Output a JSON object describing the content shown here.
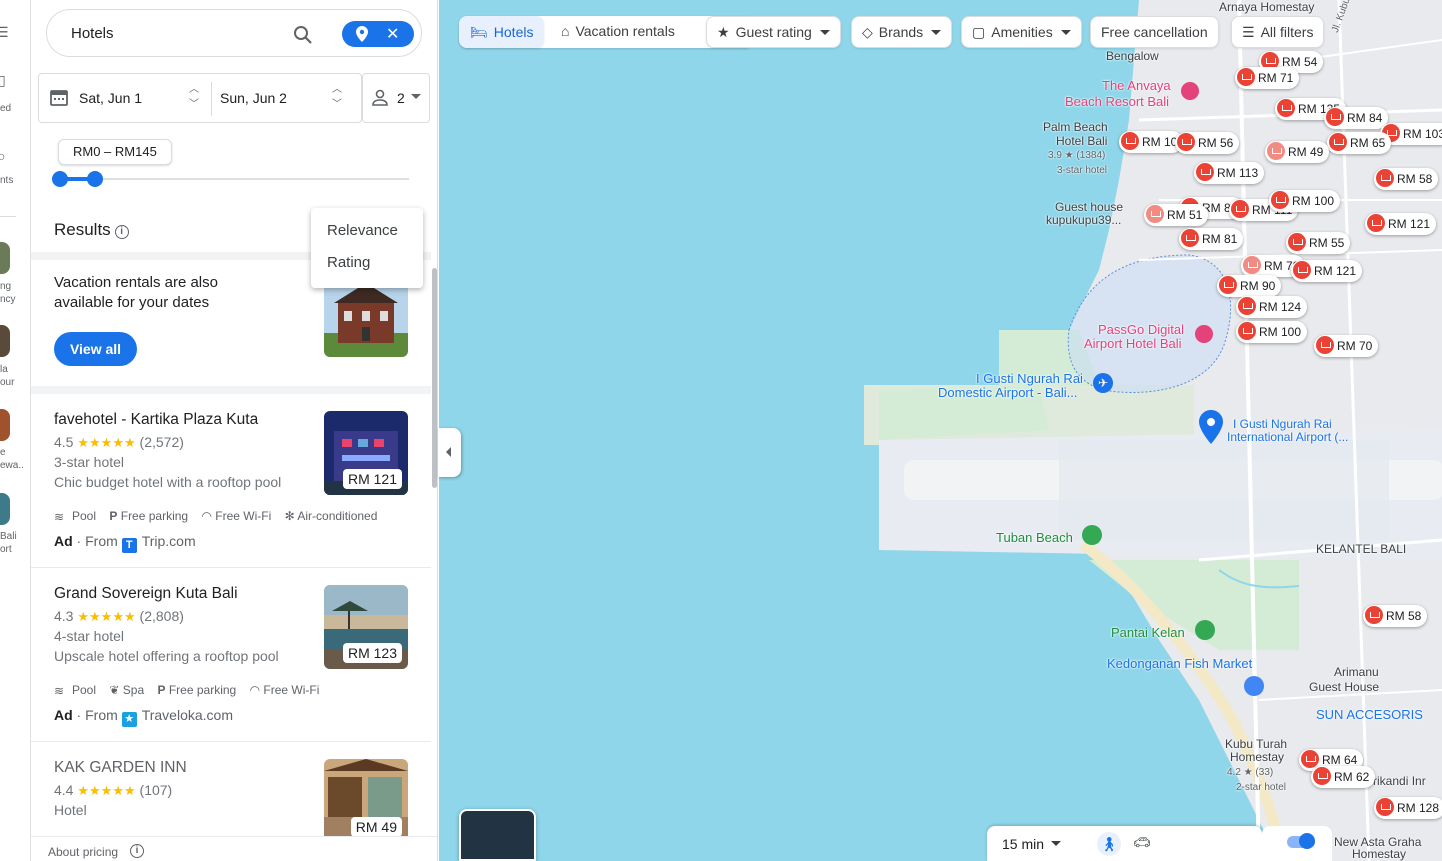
{
  "rail": {
    "fragments": [
      "ed",
      "nts",
      "ng",
      "ncy",
      "la",
      "our",
      "e",
      "ewa..",
      "Bali",
      "ort"
    ]
  },
  "search": {
    "value": "Hotels"
  },
  "dates": {
    "check_in": "Sat, Jun 1",
    "check_out": "Sun, Jun 2"
  },
  "guests": {
    "count": "2"
  },
  "price": {
    "range_label": "RM0 – RM145",
    "min_fraction": 0.0,
    "max_fraction": 0.1
  },
  "results": {
    "label": "Results",
    "info": "i"
  },
  "sort_menu": {
    "items": [
      "Relevance",
      "Rating"
    ]
  },
  "vacation_card": {
    "text": "Vacation rentals are also available for your dates",
    "button": "View all"
  },
  "hotels": [
    {
      "name": "favehotel - Kartika Plaza Kuta",
      "rating": "4.5",
      "stars": "★★★★★",
      "reviews": "(2,572)",
      "class": "3-star hotel",
      "desc": "Chic budget hotel with a rooftop pool",
      "amenities": [
        "Pool",
        "Free parking",
        "Free Wi-Fi",
        "Air-conditioned"
      ],
      "ad": "Ad",
      "from": "From",
      "source": "Trip.com",
      "source_icon": "T",
      "price": "RM 121"
    },
    {
      "name": "Grand Sovereign Kuta Bali",
      "rating": "4.3",
      "stars": "★★★★★",
      "reviews": "(2,808)",
      "class": "4-star hotel",
      "desc": "Upscale hotel offering a rooftop pool",
      "amenities": [
        "Pool",
        "Spa",
        "Free parking",
        "Free Wi-Fi"
      ],
      "ad": "Ad",
      "from": "From",
      "source": "Traveloka.com",
      "source_icon": "★",
      "price": "RM 123"
    },
    {
      "name": "KAK GARDEN INN",
      "rating": "4.4",
      "stars": "★★★★★",
      "reviews": "(107)",
      "class": "Hotel",
      "price": "RM 49"
    }
  ],
  "about_pricing": "About pricing",
  "filters": {
    "hotels": "Hotels",
    "vacation": "Vacation rentals",
    "guest_rating": "Guest rating",
    "brands": "Brands",
    "amenities": "Amenities",
    "free_cancel": "Free cancellation",
    "all_filters": "All filters"
  },
  "map_labels": {
    "arnaya": "Arnaya Homestay",
    "bengalow": "Bengalow",
    "anvaya_1": "The Anvaya",
    "anvaya_2": "Beach Resort Bali",
    "palm_1": "Palm Beach",
    "palm_2": "Hotel Bali",
    "palm_rating": "3.9 ★ (1384)",
    "palm_class": "3-star hotel",
    "guest_1": "Guest house",
    "guest_2": "kupukupu39...",
    "passgo_1": "PassGo Digital",
    "passgo_2": "Airport Hotel Bali",
    "domestic_1": "I Gusti Ngurah Rai",
    "domestic_2": "Domestic Airport - Bali...",
    "intl_1": "I Gusti Ngurah Rai",
    "intl_2": "International Airport (...",
    "tuban": "Tuban Beach",
    "kelantel": "KELANTEL BALI",
    "kelan": "Pantai Kelan",
    "fish": "Kedonganan Fish Market",
    "arimanu_1": "Arimanu",
    "arimanu_2": "Guest House",
    "sun": "SUN ACCESORIS",
    "kubu_1": "Kubu Turah",
    "kubu_2": "Homestay",
    "kubu_rating": "4.2 ★ (33)",
    "kubu_class": "2-star hotel",
    "srikandi": "Srikandi Inr",
    "newasta_1": "New Asta Graha",
    "newasta_2": "Homestay",
    "road": "Jl. Kubu Anyar"
  },
  "markers": [
    "RM 54",
    "RM 71",
    "RM 135",
    "RM 84",
    "RM 103",
    "RM 10",
    "RM 56",
    "RM 65",
    "RM 49",
    "RM 113",
    "RM 58",
    "RM 86",
    "RM 111",
    "RM 100",
    "RM 51",
    "RM 121",
    "RM 81",
    "RM 55",
    "RM 70",
    "RM 121",
    "RM 90",
    "RM 124",
    "RM 100",
    "RM 70",
    "RM 58",
    "RM 64",
    "RM 62",
    "RM 128"
  ],
  "bottom": {
    "travel_time": "15 min"
  },
  "colors": {
    "accent": "#1a73e8",
    "marker": "#ea4335",
    "water": "#8fd6ea",
    "land": "#e8eaed"
  }
}
